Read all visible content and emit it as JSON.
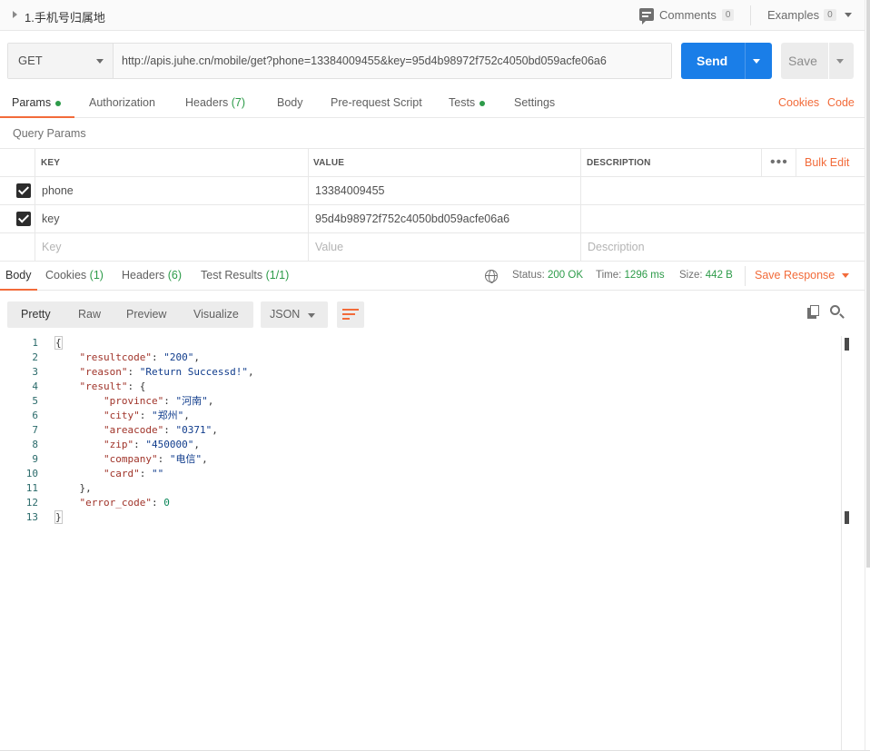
{
  "request": {
    "name": "1.手机号归属地",
    "method": "GET",
    "url": "http://apis.juhe.cn/mobile/get?phone=13384009455&key=95d4b98972f752c4050bd059acfe06a6"
  },
  "header": {
    "comments_label": "Comments",
    "comments_count": "0",
    "examples_label": "Examples",
    "examples_count": "0"
  },
  "actions": {
    "send_label": "Send",
    "save_label": "Save"
  },
  "request_tabs": [
    {
      "label": "Params",
      "count": "",
      "dot": true
    },
    {
      "label": "Authorization",
      "count": "",
      "dot": false
    },
    {
      "label": "Headers",
      "count": "(7)",
      "dot": false
    },
    {
      "label": "Body",
      "count": "",
      "dot": false
    },
    {
      "label": "Pre-request Script",
      "count": "",
      "dot": false
    },
    {
      "label": "Tests",
      "count": "",
      "dot": true
    },
    {
      "label": "Settings",
      "count": "",
      "dot": false
    }
  ],
  "links": {
    "cookies": "Cookies",
    "code": "Code"
  },
  "query_params": {
    "title": "Query Params",
    "columns": [
      "KEY",
      "VALUE",
      "DESCRIPTION"
    ],
    "bulk_edit": "Bulk Edit",
    "rows": [
      {
        "checked": true,
        "key": "phone",
        "value": "13384009455",
        "description": ""
      },
      {
        "checked": true,
        "key": "key",
        "value": "95d4b98972f752c4050bd059acfe06a6",
        "description": ""
      }
    ],
    "placeholders": {
      "key": "Key",
      "value": "Value",
      "description": "Description"
    }
  },
  "response_tabs": [
    {
      "label": "Body",
      "count": ""
    },
    {
      "label": "Cookies",
      "count": "(1)"
    },
    {
      "label": "Headers",
      "count": "(6)"
    },
    {
      "label": "Test Results",
      "count": "(1/1)"
    }
  ],
  "response_meta": {
    "status_label": "Status:",
    "status_value": "200 OK",
    "time_label": "Time:",
    "time_value": "1296 ms",
    "size_label": "Size:",
    "size_value": "442 B",
    "save_response": "Save Response"
  },
  "view_modes": [
    "Pretty",
    "Raw",
    "Preview",
    "Visualize"
  ],
  "format": "JSON",
  "code_lines": [
    "{",
    "    \"resultcode\": \"200\",",
    "    \"reason\": \"Return Successd!\",",
    "    \"result\": {",
    "        \"province\": \"河南\",",
    "        \"city\": \"郑州\",",
    "        \"areacode\": \"0371\",",
    "        \"zip\": \"450000\",",
    "        \"company\": \"电信\",",
    "        \"card\": \"\"",
    "    },",
    "    \"error_code\": 0",
    "}"
  ]
}
